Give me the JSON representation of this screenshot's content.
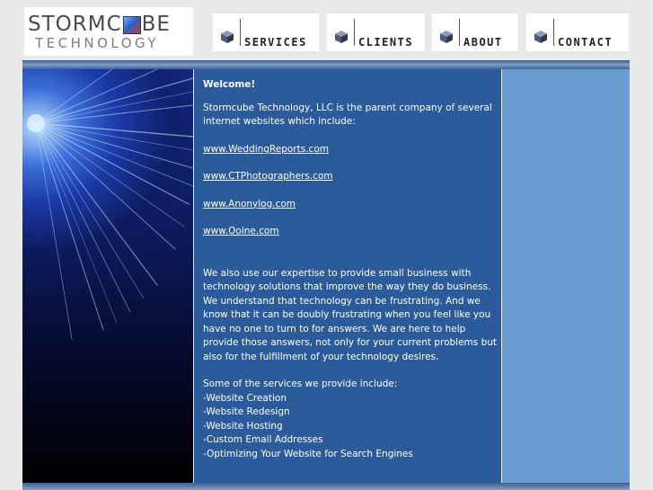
{
  "logo": {
    "line1_a": "STORMC",
    "line1_b": "BE",
    "line2": "TECHNOLOGY"
  },
  "nav": [
    {
      "label": "SERVICES",
      "icon": "cube-icon"
    },
    {
      "label": "CLIENTS",
      "icon": "cube-icon"
    },
    {
      "label": "ABOUT",
      "icon": "cube-icon"
    },
    {
      "label": "CONTACT",
      "icon": "cube-icon"
    }
  ],
  "content": {
    "heading": "Welcome!",
    "intro": "Stormcube Technology, LLC is the parent company of several internet websites which include:",
    "links": [
      "www.WeddingReports.com",
      "www.CTPhotographers.com",
      "www.Anonylog.com",
      "www.Ooine.com"
    ],
    "body": "We also use our expertise to provide small business with technology solutions that improve the way they do business. We understand that technology can be frustrating. And we know that it can be doubly frustrating when you feel like you have no one to turn to for answers. We are here to help provide those answers, not only for your current problems but also for the fulfillment of your technology desires.",
    "services_intro": "Some of the services we provide include:",
    "services": [
      "-Website Creation",
      "-Website Redesign",
      "-Website Hosting",
      "-Custom Email Addresses",
      "-Optimizing Your Website for Search Engines"
    ]
  },
  "colors": {
    "content_bg": "#2b5b9a",
    "right_panel_bg": "#6b9cd0",
    "page_bg": "#e9e9e9"
  }
}
